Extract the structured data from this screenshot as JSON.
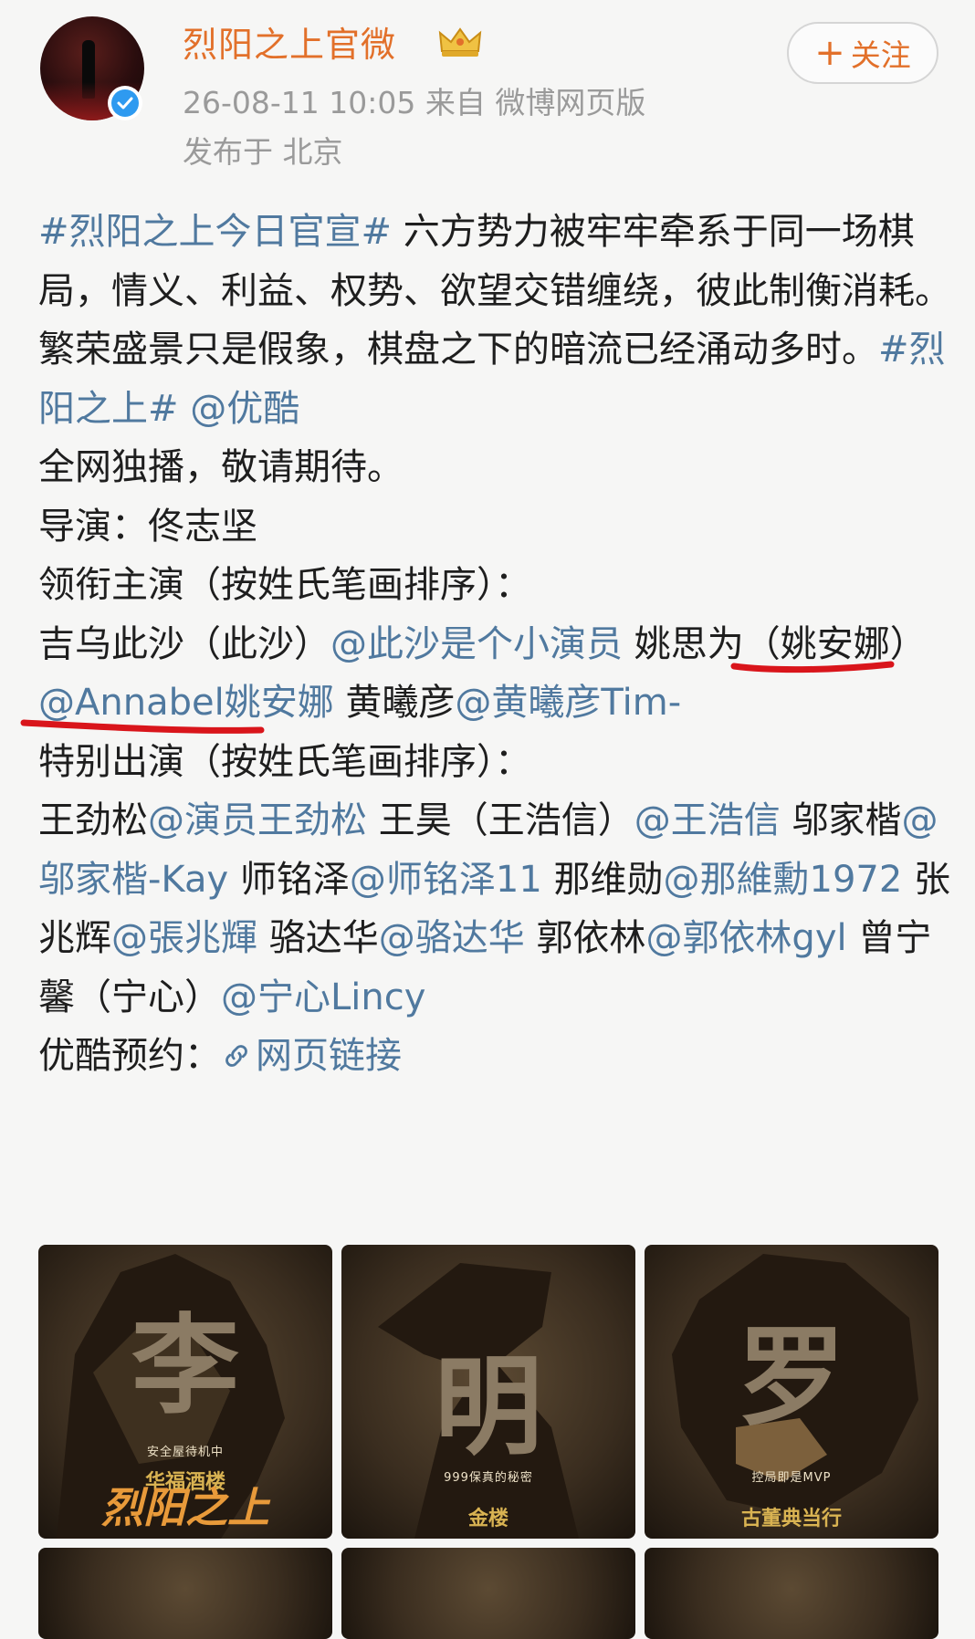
{
  "header": {
    "account_name": "烈阳之上官微",
    "post_meta": "26-08-11 10:05  来自 微博网页版",
    "location": "发布于 北京",
    "follow_label": "关注",
    "follow_icon": "plus-icon",
    "badge_icons": [
      "verified-icon",
      "crown-icon"
    ]
  },
  "post": {
    "l1_tag": "#烈阳之上今日官宣#",
    "l1_text": " 六方势力被牢牢牵系于同一场棋局，情义、利益、权势、欲望交错缠绕，彼此制衡消耗。繁荣盛景只是假象，棋盘之下的暗流已经涌动多时。",
    "l1_tag2": "#烈阳之上#",
    "l1_sp": " ",
    "l1_mention": "@优酷",
    "l1_end": "全网独播，敬请期待。",
    "director": "导演：佟志坚",
    "lead_heading": "领衔主演（按姓氏笔画排序）：",
    "lead_1_name": "吉乌此沙（此沙）",
    "lead_1_mention": "@此沙是个小演员",
    "lead_2_name": "姚思为（姚安娜）",
    "lead_2_mention": "@Annabel姚安娜",
    "lead_3_name": "黄曦彦",
    "lead_3_mention": "@黄曦彦Tim-",
    "special_heading": "特别出演（按姓氏笔画排序）：",
    "sp_1_name": "王劲松",
    "sp_1_mention": "@演员王劲松",
    "sp_2_name": "王昊（王浩信）",
    "sp_2_mention": "@王浩信",
    "sp_3_name": "邬家楷",
    "sp_3_mention": "@邬家楷-Kay",
    "sp_4_name": "师铭泽",
    "sp_4_mention": "@师铭泽11",
    "sp_5_name": "那维勋",
    "sp_5_mention": "@那維勳1972",
    "sp_6_name": "张兆辉",
    "sp_6_mention": "@張兆輝",
    "sp_7_name": "骆达华",
    "sp_7_mention": "@骆达华",
    "sp_8_name": "郭依林",
    "sp_8_mention": "@郭依林gyl",
    "sp_9_name": "曾宁馨（宁心）",
    "sp_9_mention": "@宁心Lincy",
    "youku_label": "优酷预约：",
    "link_label": "网页链接",
    "link_icon": "link-icon"
  },
  "posters": [
    {
      "char": "李",
      "caption": "安全屋待机中",
      "subtitle": "华福酒楼",
      "title": "烈阳之上"
    },
    {
      "char": "明",
      "caption": "999保真的秘密",
      "subtitle": "金楼",
      "title": ""
    },
    {
      "char": "罗",
      "caption": "控局即是MVP",
      "subtitle": "古董典当行",
      "title": ""
    }
  ],
  "accent_colors": {
    "brand_orange": "#e2702a",
    "link_blue": "#50799f",
    "highlight_red": "#d9151b"
  }
}
